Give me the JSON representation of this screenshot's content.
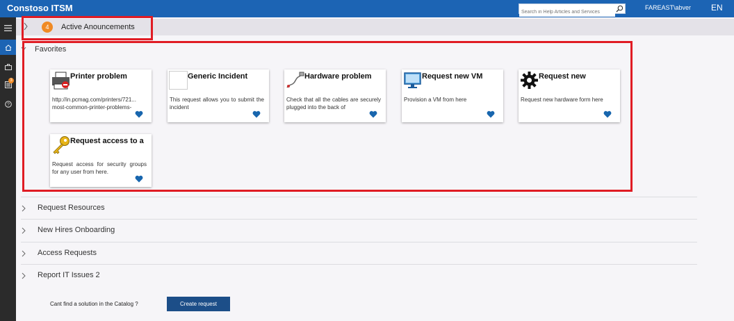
{
  "header": {
    "app_title": "Constoso ITSM",
    "search_placeholder": "Search in Help Articles and Services",
    "user": "FAREAST\\abver",
    "language": "EN"
  },
  "nav": {
    "items": [
      {
        "icon": "menu-icon"
      },
      {
        "icon": "home-icon",
        "active": true
      },
      {
        "icon": "briefcase-icon"
      },
      {
        "icon": "tasks-icon",
        "badge": "3"
      },
      {
        "icon": "help-icon"
      }
    ]
  },
  "announcements": {
    "count": "4",
    "label": "Active Anouncements"
  },
  "favorites": {
    "label": "Favorites",
    "cards": [
      {
        "title": "Printer problem",
        "desc": "http://in.pcmag.com/printers/721... most-common-printer-problems-",
        "icon": "printer-icon"
      },
      {
        "title": "Generic Incident",
        "desc": "This request allows you to submit the incident",
        "icon": "blank-image-icon"
      },
      {
        "title": "Hardware problem",
        "desc": "Check that all the cables are securely plugged into the back of",
        "icon": "cable-icon"
      },
      {
        "title": "Request new VM",
        "desc": "Provision a VM from here",
        "icon": "monitor-icon"
      },
      {
        "title": "Request new",
        "desc": "Request new hardware form here",
        "icon": "gear-icon"
      },
      {
        "title": "Request access to a",
        "desc": "Request access for security groups for any user from here.",
        "icon": "key-icon"
      }
    ]
  },
  "sections": [
    {
      "label": "Request Resources"
    },
    {
      "label": "New Hires Onboarding"
    },
    {
      "label": "Access Requests"
    },
    {
      "label": "Report IT Issues 2"
    }
  ],
  "footer": {
    "prompt": "Cant find a solution in the Catalog ?",
    "button": "Create request"
  },
  "colors": {
    "header_blue": "#1c64b4",
    "badge_orange": "#f08a24",
    "highlight_red": "#e01c24",
    "button_blue": "#1c4e88",
    "heart_blue": "#1866ae"
  }
}
